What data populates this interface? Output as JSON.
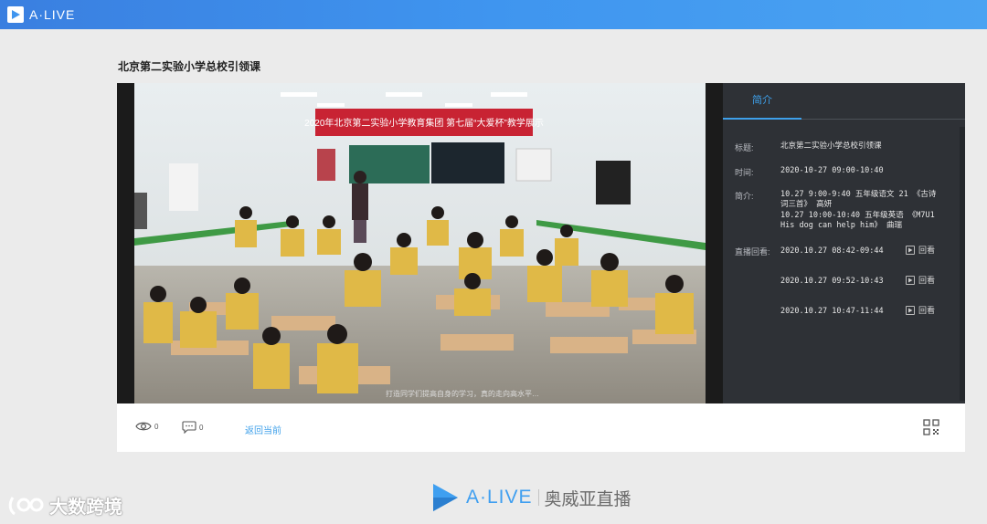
{
  "header": {
    "brand": "A·LIVE",
    "logo_icon": "play-triangle-logo-icon"
  },
  "page": {
    "title": "北京第二实验小学总校引领课"
  },
  "video": {
    "banner": "2020年北京第二实验小学教育集团 第七届“大爱杯”教学展示",
    "subtitle": "打造同学们提高自身的学习，真的走向高水平…"
  },
  "panel": {
    "tab_label": "简介",
    "title_label": "标题:",
    "title_value": "北京第二实验小学总校引领课",
    "time_label": "时间:",
    "time_value": "2020-10-27 09:00-10:40",
    "intro_label": "简介:",
    "intro_lines": [
      "10.27 9:00-9:40 五年级语文 21 《古诗",
      "词三首》 高妍",
      "10.27 10:00-10:40 五年级英语 《M7U1",
      "His dog can help him》 曲瑞"
    ],
    "replay_label": "直播回看:",
    "replays": [
      {
        "time": "2020.10.27 08:42-09:44",
        "button": "回看"
      },
      {
        "time": "2020.10.27 09:52-10:43",
        "button": "回看"
      },
      {
        "time": "2020.10.27 10:47-11:44",
        "button": "回看"
      }
    ]
  },
  "footer": {
    "views_icon": "eye-icon",
    "views_count": "0",
    "comments_icon": "comment-icon",
    "comments_count": "0",
    "back_link": "返回当前",
    "qr_icon": "qr-code-icon"
  },
  "bottom_brand": {
    "name": "A·LIVE",
    "cn": "奥威亚直播"
  },
  "watermark": {
    "text": "大数跨境"
  },
  "colors": {
    "accent": "#3ea0ea",
    "topbar": "#3f95ef",
    "panel_bg": "#2e3136",
    "page_bg": "#ebebeb"
  }
}
